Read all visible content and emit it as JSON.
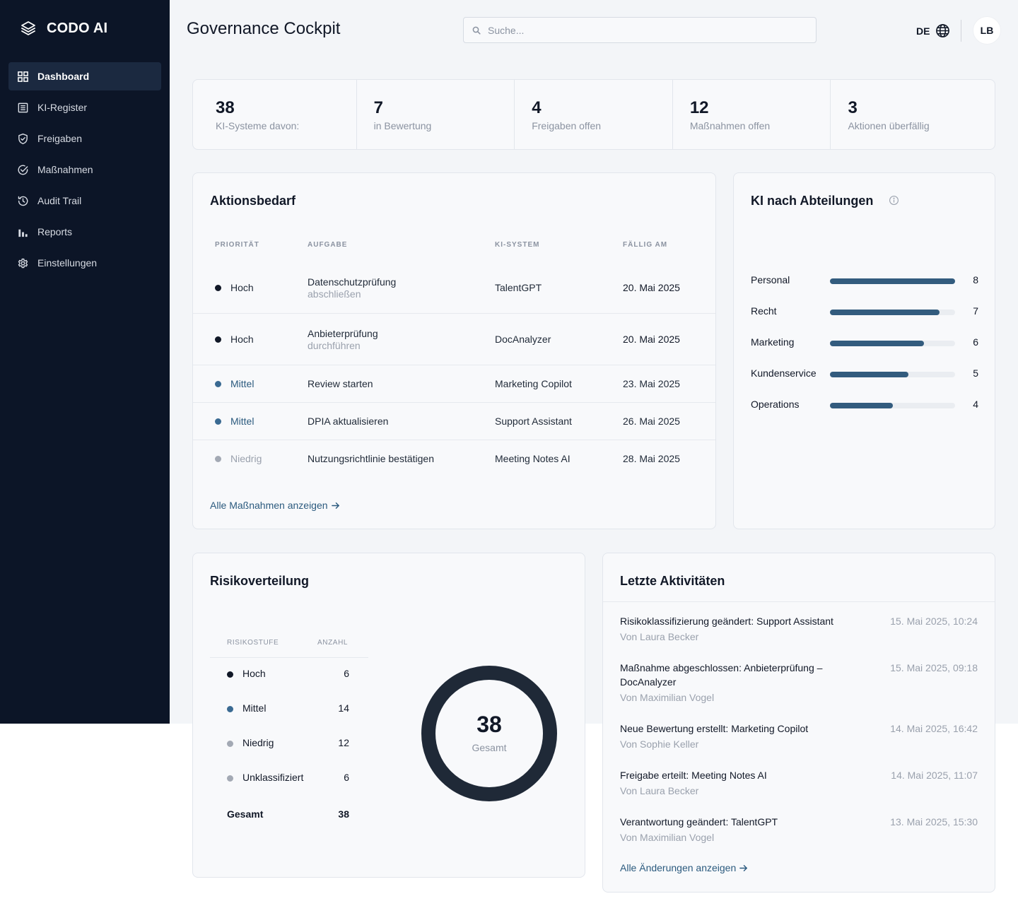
{
  "brand": {
    "name": "CODO AI"
  },
  "sidebar": {
    "items": [
      {
        "label": "Dashboard",
        "icon": "grid-icon",
        "active": true
      },
      {
        "label": "KI-Register",
        "icon": "list-icon"
      },
      {
        "label": "Freigaben",
        "icon": "shield-check-icon"
      },
      {
        "label": "Maßnahmen",
        "icon": "check-circle-icon"
      },
      {
        "label": "Audit Trail",
        "icon": "history-icon"
      },
      {
        "label": "Reports",
        "icon": "bar-chart-icon"
      },
      {
        "label": "Einstellungen",
        "icon": "gear-icon"
      }
    ]
  },
  "header": {
    "title": "Governance Cockpit",
    "search_placeholder": "Suche...",
    "language": "DE",
    "user_initials": "LB"
  },
  "kpis": [
    {
      "value": "38",
      "label": "KI-Systeme davon:"
    },
    {
      "value": "7",
      "label": "in Bewertung"
    },
    {
      "value": "4",
      "label": "Freigaben offen"
    },
    {
      "value": "12",
      "label": "Maßnahmen offen"
    },
    {
      "value": "3",
      "label": "Aktionen überfällig"
    }
  ],
  "actions": {
    "title": "Aktionsbedarf",
    "headers": {
      "priority": "PRIORITÄT",
      "task": "AUFGABE",
      "system": "KI-SYSTEM",
      "due": "FÄLLIG AM"
    },
    "rows": [
      {
        "priority": "Hoch",
        "level": "high",
        "task": "Datenschutzprüfung",
        "task_sub": "abschließen",
        "system": "TalentGPT",
        "due": "20. Mai 2025"
      },
      {
        "priority": "Hoch",
        "level": "high",
        "task": "Anbieterprüfung",
        "task_sub": "durchführen",
        "system": "DocAnalyzer",
        "due": "20. Mai 2025"
      },
      {
        "priority": "Mittel",
        "level": "medium",
        "task": "Review starten",
        "task_sub": "",
        "system": "Marketing Copilot",
        "due": "23. Mai 2025"
      },
      {
        "priority": "Mittel",
        "level": "medium",
        "task": "DPIA aktualisieren",
        "task_sub": "",
        "system": "Support Assistant",
        "due": "26. Mai 2025"
      },
      {
        "priority": "Niedrig",
        "level": "low",
        "task": "Nutzungsrichtlinie bestätigen",
        "task_sub": "",
        "system": "Meeting Notes AI",
        "due": "28. Mai 2025"
      }
    ],
    "link": "Alle Maßnahmen anzeigen"
  },
  "departments": {
    "title": "KI nach Abteilungen",
    "max": 8,
    "items": [
      {
        "name": "Personal",
        "value": 8
      },
      {
        "name": "Recht",
        "value": 7
      },
      {
        "name": "Marketing",
        "value": 6
      },
      {
        "name": "Kundenservice",
        "value": 5
      },
      {
        "name": "Operations",
        "value": 4
      }
    ]
  },
  "risk": {
    "title": "Risikoverteilung",
    "headers": {
      "level": "RISIKOSTUFE",
      "count": "ANZAHL"
    },
    "rows": [
      {
        "label": "Hoch",
        "value": "6",
        "color": "#111827"
      },
      {
        "label": "Mittel",
        "value": "14",
        "color": "#3a6a92"
      },
      {
        "label": "Niedrig",
        "value": "12",
        "color": "#a3a9b4"
      },
      {
        "label": "Unklassifiziert",
        "value": "6",
        "color": "#a3a9b4"
      }
    ],
    "total_label": "Gesamt",
    "total_value": "38",
    "donut_value": "38",
    "donut_label": "Gesamt"
  },
  "activities": {
    "title": "Letzte Aktivitäten",
    "items": [
      {
        "title": "Risikoklassifizierung geändert: Support Assistant",
        "by": "Von Laura Becker",
        "time": "15. Mai 2025, 10:24"
      },
      {
        "title": "Maßnahme abgeschlossen: Anbieterprüfung – DocAnalyzer",
        "by": "Von Maximilian Vogel",
        "time": "15. Mai 2025, 09:18"
      },
      {
        "title": "Neue Bewertung erstellt: Marketing Copilot",
        "by": "Von Sophie Keller",
        "time": "14. Mai 2025, 16:42"
      },
      {
        "title": "Freigabe erteilt: Meeting Notes AI",
        "by": "Von Laura Becker",
        "time": "14. Mai 2025, 11:07"
      },
      {
        "title": "Verantwortung geändert: TalentGPT",
        "by": "Von Maximilian Vogel",
        "time": "13. Mai 2025, 15:30"
      }
    ],
    "link": "Alle Änderungen anzeigen"
  },
  "colors": {
    "sidebar_bg": "#0c1527",
    "accent": "#335c7e",
    "link": "#2b5a7e",
    "priority_high": "#111827",
    "priority_medium": "#3a6a92",
    "priority_low": "#a3a9b4"
  }
}
